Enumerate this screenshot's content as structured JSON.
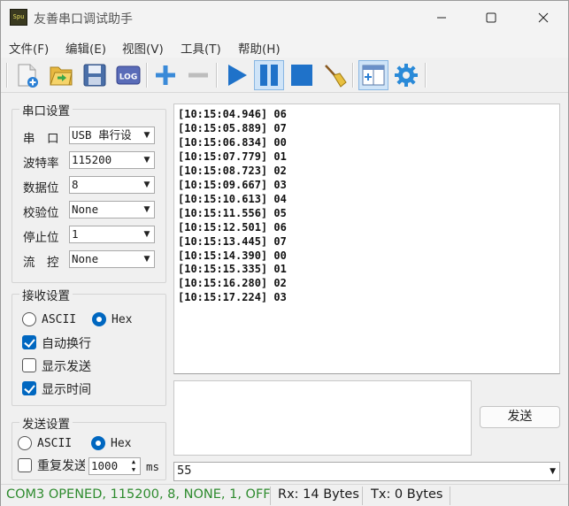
{
  "app": {
    "title": "友善串口调试助手",
    "icon_text": "Spu",
    "window_controls": {
      "minimize": "—",
      "maximize": "☐",
      "close": "✕"
    }
  },
  "menu": [
    "文件(F)",
    "编辑(E)",
    "视图(V)",
    "工具(T)",
    "帮助(H)"
  ],
  "toolbar": {
    "items": [
      "new-file-icon",
      "open-folder-icon",
      "save-icon",
      "log-icon",
      "add-icon",
      "remove-icon",
      "play-icon",
      "pause-icon",
      "stop-icon",
      "broom-clear-icon",
      "window-layout-icon",
      "settings-gear-icon"
    ],
    "log_label": "LOG",
    "active": [
      "pause-icon",
      "window-layout-icon"
    ]
  },
  "serial_settings": {
    "title": "串口设置",
    "fields": [
      {
        "label": "串　口",
        "value": "USB 串行设"
      },
      {
        "label": "波特率",
        "value": "115200"
      },
      {
        "label": "数据位",
        "value": "8"
      },
      {
        "label": "校验位",
        "value": "None"
      },
      {
        "label": "停止位",
        "value": "1"
      },
      {
        "label": "流　控",
        "value": "None"
      }
    ]
  },
  "receive_settings": {
    "title": "接收设置",
    "radio_ascii": "ASCII",
    "radio_hex": "Hex",
    "selected": "Hex",
    "auto_newline": {
      "label": "自动换行",
      "checked": true
    },
    "show_send": {
      "label": "显示发送",
      "checked": false
    },
    "show_time": {
      "label": "显示时间",
      "checked": true
    }
  },
  "send_settings": {
    "title": "发送设置",
    "radio_ascii": "ASCII",
    "radio_hex": "Hex",
    "selected": "Hex",
    "repeat": {
      "label": "重复发送",
      "checked": false
    },
    "interval": "1000",
    "unit": "ms"
  },
  "receive_log": [
    "[10:15:04.946] 06",
    "[10:15:05.889] 07",
    "[10:15:06.834] 00",
    "[10:15:07.779] 01",
    "[10:15:08.723] 02",
    "[10:15:09.667] 03",
    "[10:15:10.613] 04",
    "[10:15:11.556] 05",
    "[10:15:12.501] 06",
    "[10:15:13.445] 07",
    "[10:15:14.390] 00",
    "[10:15:15.335] 01",
    "[10:15:16.280] 02",
    "[10:15:17.224] 03"
  ],
  "send_button": "发送",
  "send_history_value": "55",
  "status": {
    "port": "COM3 OPENED, 115200, 8, NONE, 1, OFF",
    "rx": "Rx: 14 Bytes",
    "tx": "Tx: 0 Bytes",
    "port_color": "#2e8b2e"
  }
}
